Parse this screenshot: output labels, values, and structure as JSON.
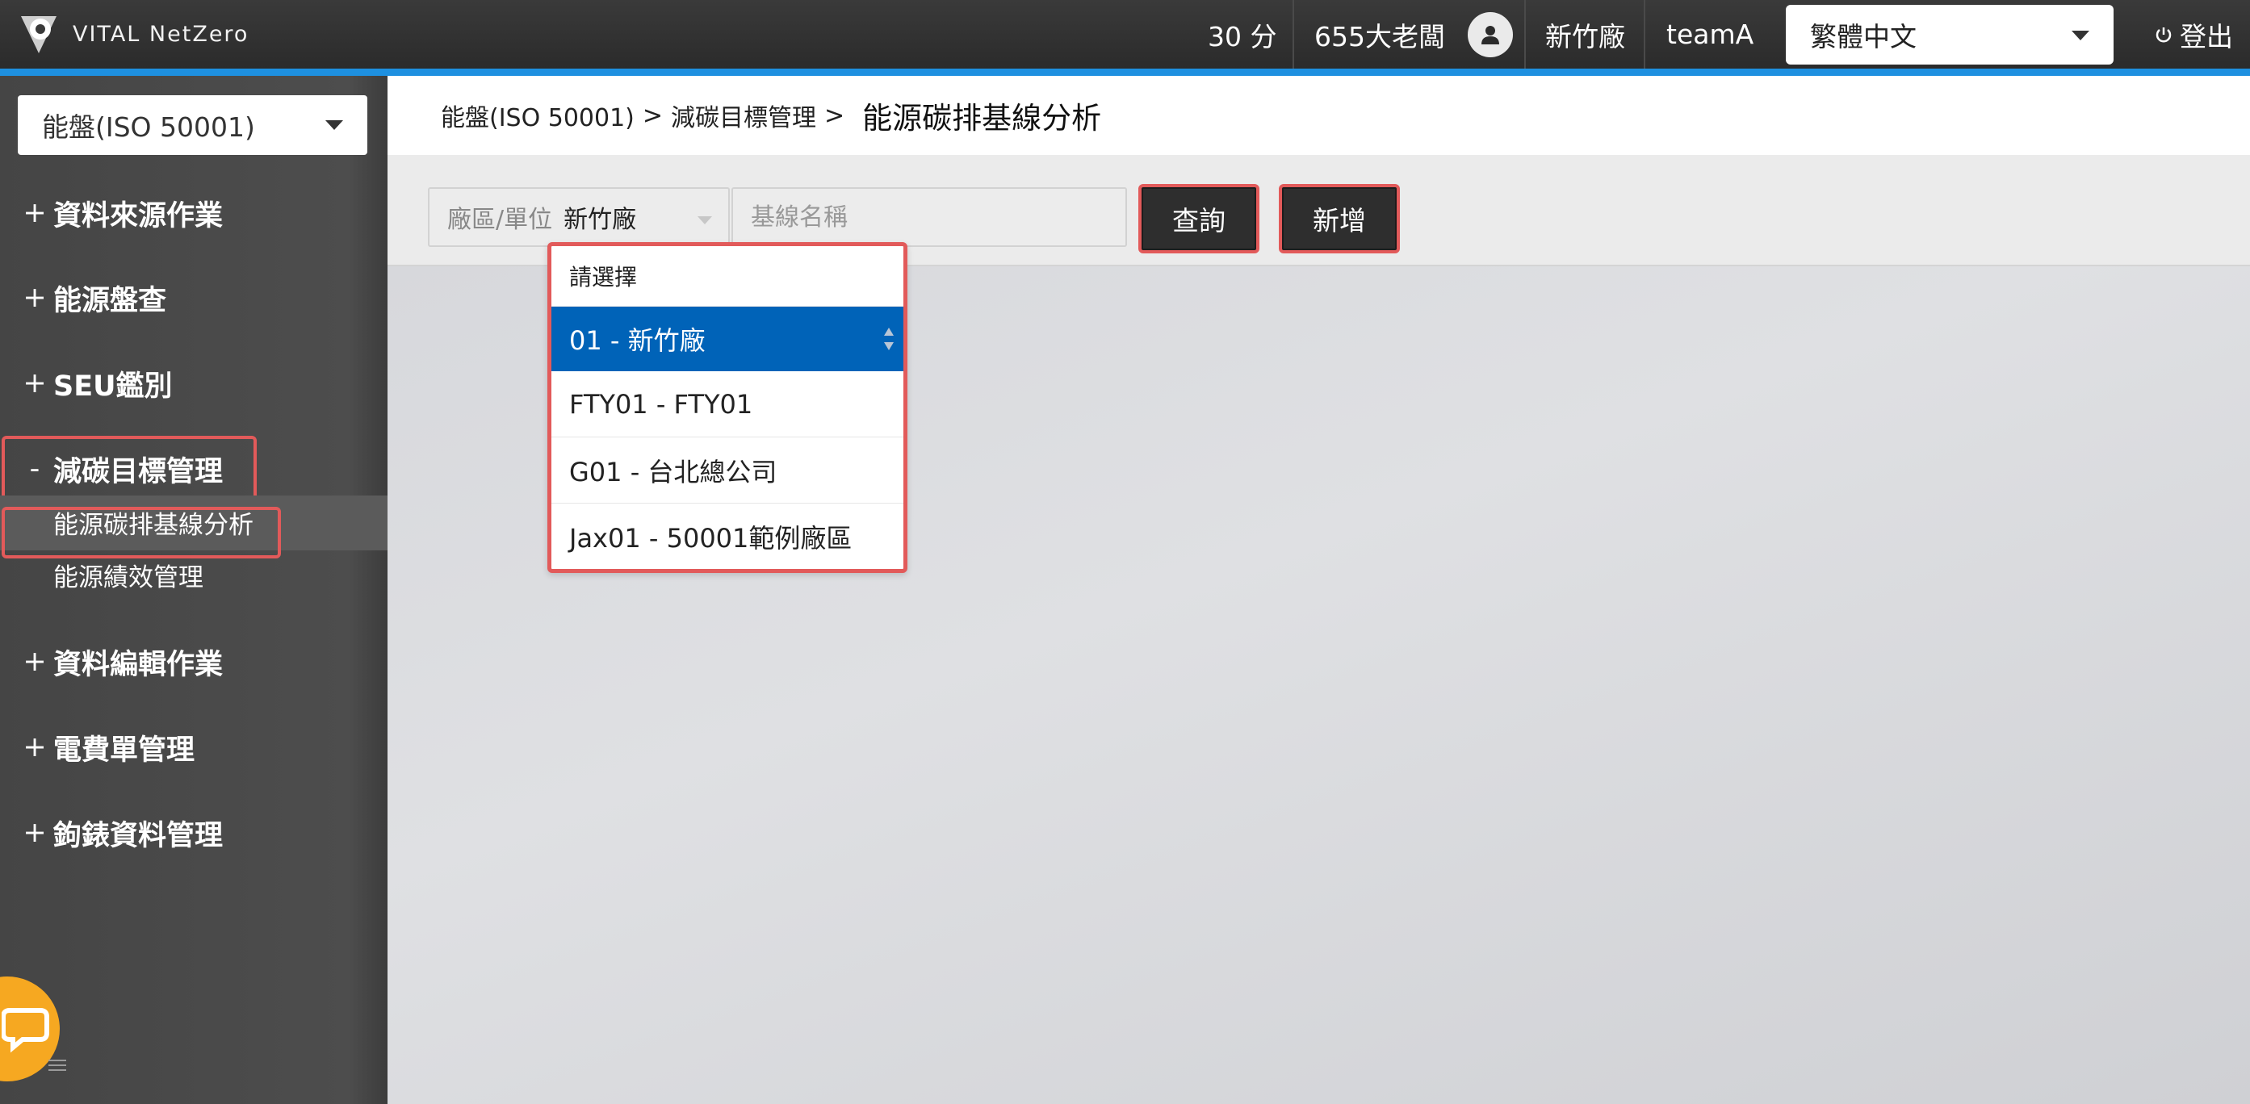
{
  "app": {
    "logo_text": "VITAL NetZero",
    "accent_color": "#1e90e0"
  },
  "topbar": {
    "points": "30 分",
    "user_name": "655大老闆",
    "factory": "新竹廠",
    "team": "teamA",
    "language": "繁體中文",
    "logout": "登出"
  },
  "sidebar": {
    "module_select": "能盤(ISO 50001)",
    "menu": [
      {
        "sign": "+",
        "label": "資料來源作業"
      },
      {
        "sign": "+",
        "label": "能源盤查"
      },
      {
        "sign": "+",
        "label": "SEU鑑別"
      },
      {
        "sign": "-",
        "label": "減碳目標管理"
      },
      {
        "sign": "+",
        "label": "資料編輯作業"
      },
      {
        "sign": "+",
        "label": "電費單管理"
      },
      {
        "sign": "+",
        "label": "鉤錶資料管理"
      }
    ],
    "submenu": [
      {
        "label": "能源碳排基線分析"
      },
      {
        "label": "能源績效管理"
      }
    ]
  },
  "breadcrumb": {
    "level1": "能盤(ISO 50001)",
    "level2": "減碳目標管理",
    "separator": ">",
    "current": "能源碳排基線分析"
  },
  "toolbar": {
    "filter_label": "廠區/單位",
    "filter_value": "新竹廠",
    "name_placeholder": "基線名稱",
    "query_button": "查詢",
    "add_button": "新增"
  },
  "dropdown": {
    "placeholder": "請選擇",
    "options": [
      {
        "label": "01 - 新竹廠",
        "selected": true
      },
      {
        "label": "FTY01 - FTY01",
        "selected": false
      },
      {
        "label": "G01 - 台北總公司",
        "selected": false
      },
      {
        "label": "Jax01 - 50001範例廠區",
        "selected": false
      }
    ],
    "selected_color": "#0063b8"
  },
  "highlight_color": "#e25a5a"
}
